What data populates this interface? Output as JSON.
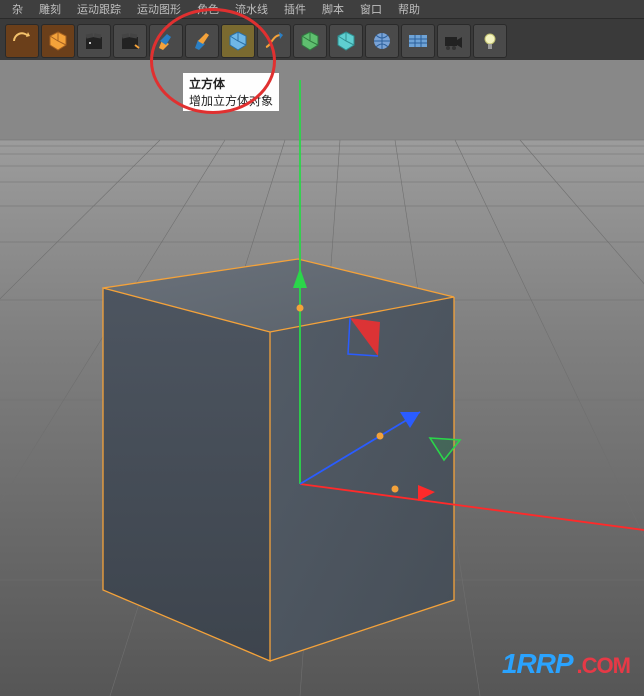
{
  "menu": {
    "items": [
      "杂",
      "雕刻",
      "运动跟踪",
      "运动图形",
      "角色",
      "流水线",
      "插件",
      "脚本",
      "窗口",
      "帮助"
    ]
  },
  "toolbar": {
    "icons": [
      "undo-arc",
      "cube-orange",
      "clap-a",
      "clap-b",
      "pen-a",
      "pen-b",
      "cube-blue",
      "pen-c",
      "cube-green",
      "cube-cyan",
      "globe-a",
      "grid-a",
      "camera-a",
      "bulb-a"
    ]
  },
  "tooltip": {
    "title": "立方体",
    "desc": "增加立方体对象"
  },
  "watermark": {
    "main": "1RRP",
    "suffix": ".COM"
  }
}
